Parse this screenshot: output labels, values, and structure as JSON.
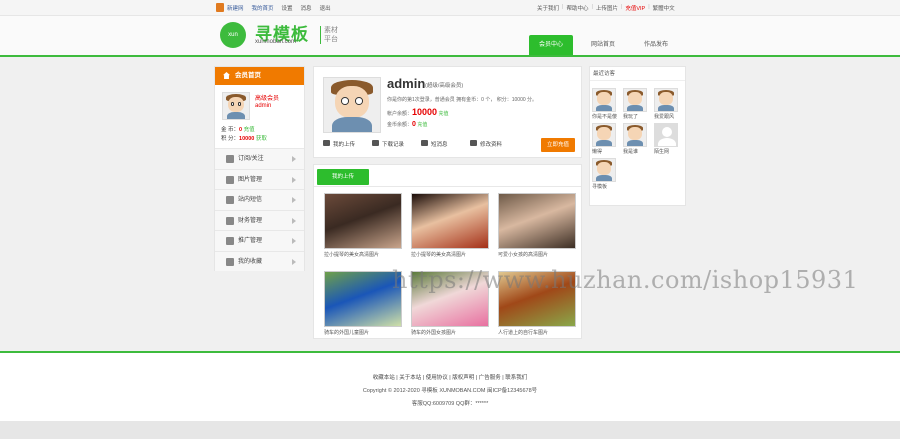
{
  "topbar": {
    "left_links": [
      "新建网",
      "我的首页",
      "设置",
      "消息",
      "退出"
    ],
    "right_links": [
      "关于我们",
      "帮助中心",
      "上传图片",
      "充值VIP",
      "繁體中文"
    ]
  },
  "header": {
    "logo_mark": "xun",
    "logo_text": "寻模板",
    "logo_sub": "xunmoban.com",
    "logo_tag": "素材平台",
    "nav": [
      "会员中心",
      "网站首页",
      "作品发布"
    ]
  },
  "sidebar": {
    "title": "会员首页",
    "level": "高级会员",
    "username": "admin",
    "coins_label": "金 币：",
    "coins_value": "0",
    "coins_action": "充值",
    "points_label": "积 分：",
    "points_value": "10000",
    "points_action": "获取",
    "menu": [
      "订阅/关注",
      "图片管理",
      "站内短信",
      "财务管理",
      "推广管理",
      "我的收藏"
    ]
  },
  "profile": {
    "name": "admin",
    "role": "(超级/高级会员)",
    "line1": "你是你的第1次登录，普通会员 拥有金币：0 个， 积分：10000 分。",
    "balance_label": "帐户余额：",
    "balance_value": "10000",
    "balance_action": "充值",
    "gold_label": "金币余额：",
    "gold_value": "0",
    "gold_action": "充值",
    "actions": [
      "我的上传",
      "下载记录",
      "短消息",
      "修改资料"
    ],
    "recharge_button": "立即充值"
  },
  "uploads": {
    "tab": "我的上传",
    "items": [
      {
        "caption": "拉小提琴的美女高清图片",
        "colors": [
          "#6b4a3a",
          "#c9a58c",
          "#3a2a22"
        ]
      },
      {
        "caption": "拉小提琴的美女高清图片",
        "colors": [
          "#1a0c08",
          "#a43018",
          "#e8c0a0"
        ]
      },
      {
        "caption": "可爱小女孩的高清图片",
        "colors": [
          "#6e5a48",
          "#3c2e24",
          "#d8b8a0"
        ]
      },
      {
        "caption": "骑车的外国儿童图片",
        "colors": [
          "#6fa04a",
          "#cfe0a8",
          "#1a56b8"
        ]
      },
      {
        "caption": "骑车的外国女孩图片",
        "colors": [
          "#5a7a3a",
          "#e870a0",
          "#f0d8d8"
        ]
      },
      {
        "caption": "人行道上的自行车图片",
        "colors": [
          "#e0c890",
          "#8aa84a",
          "#a04818"
        ]
      }
    ]
  },
  "visitors": {
    "title": "最近访客",
    "items": [
      "你是不是傻",
      "我玩了",
      "我爱跟风",
      "懒得",
      "我是谁",
      "陌生网",
      "寻模板"
    ]
  },
  "footer": {
    "links": "收藏本站 | 关于本站 | 使用协议 | 版权声明 | 广告服务 | 联系我们",
    "copyright": "Copyright © 2012-2020 寻模板 XUNMOBAN.COM 闽ICP备12345678号",
    "qq": "客服QQ:6009709 QQ群：******"
  },
  "watermark": "https://www.huzhan.com/ishop15931",
  "colors": {
    "accent_green": "#2dbd2d",
    "accent_orange": "#f07a00",
    "highlight_red": "#e60000"
  }
}
